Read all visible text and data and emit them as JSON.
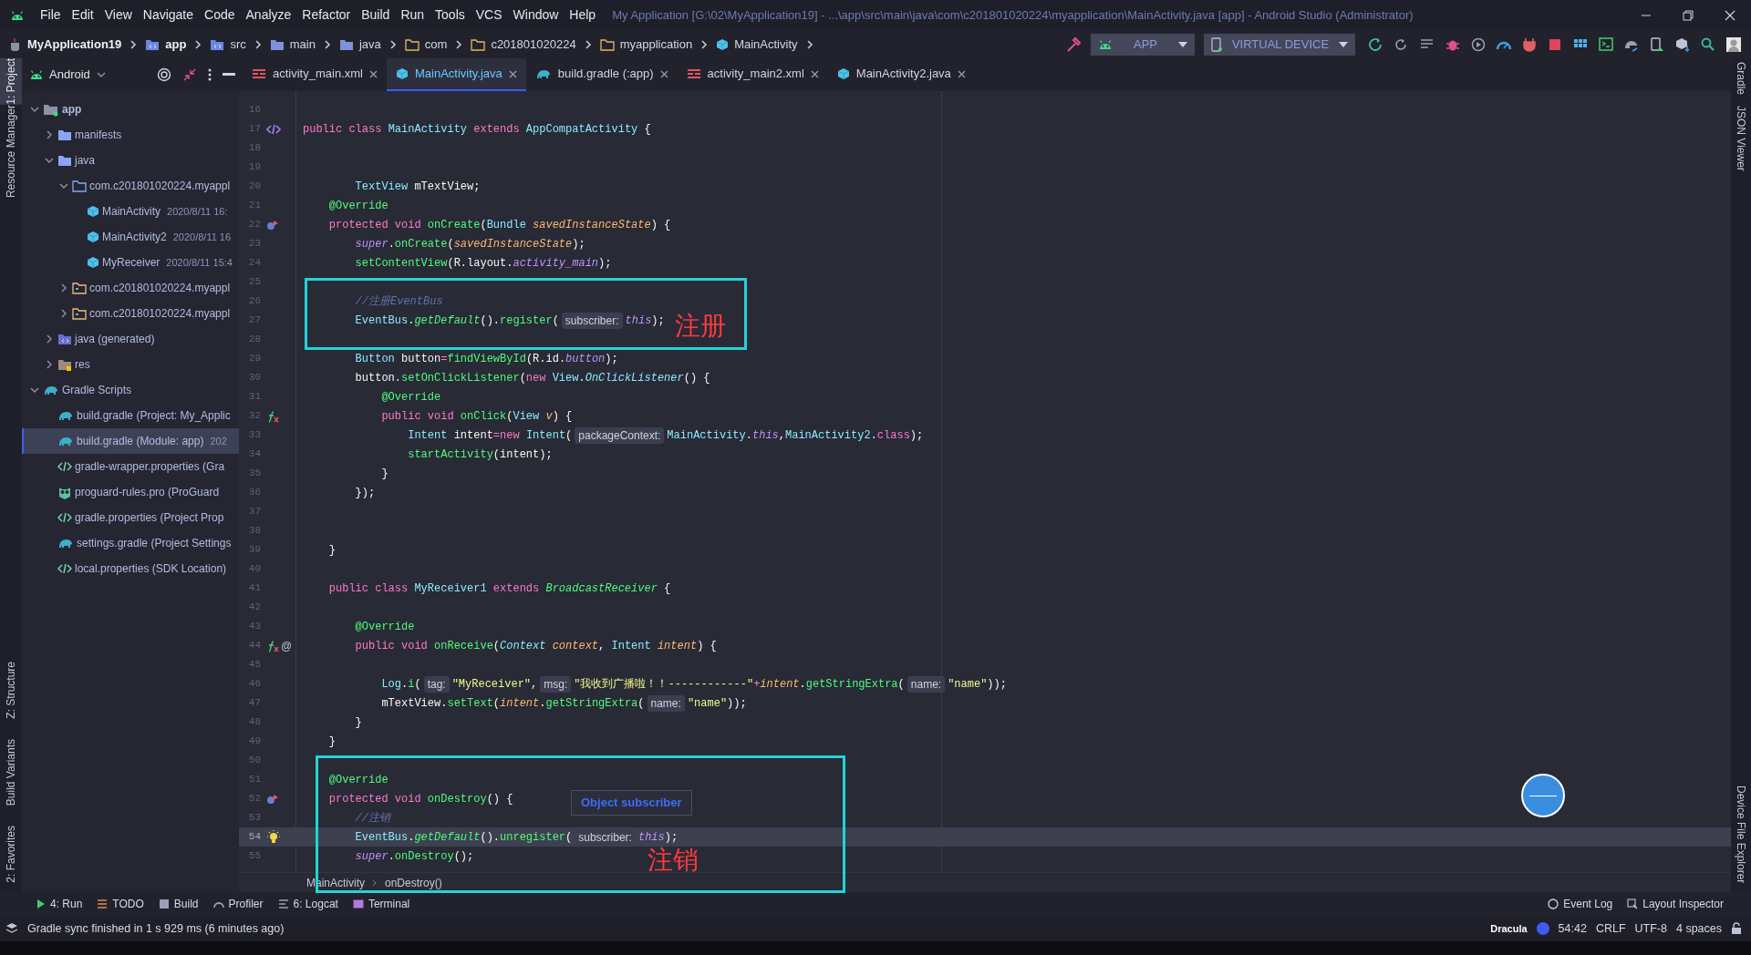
{
  "window": {
    "title": "My Application [G:\\02\\MyApplication19] - ...\\app\\src\\main\\java\\com\\c201801020224\\myapplication\\MainActivity.java [app] - Android Studio (Administrator)"
  },
  "menu": [
    "File",
    "Edit",
    "View",
    "Navigate",
    "Code",
    "Analyze",
    "Refactor",
    "Build",
    "Run",
    "Tools",
    "VCS",
    "Window",
    "Help"
  ],
  "breadcrumb": [
    {
      "label": "MyApplication19",
      "kind": "project"
    },
    {
      "label": "app",
      "kind": "module"
    },
    {
      "label": "src",
      "kind": "source"
    },
    {
      "label": "main",
      "kind": "folder"
    },
    {
      "label": "java",
      "kind": "folder"
    },
    {
      "label": "com",
      "kind": "package"
    },
    {
      "label": "c201801020224",
      "kind": "package"
    },
    {
      "label": "myapplication",
      "kind": "package"
    },
    {
      "label": "MainActivity",
      "kind": "class"
    }
  ],
  "toolbar": {
    "run_config": "APP",
    "device": "VIRTUAL DEVICE"
  },
  "left_strip": {
    "top": [
      {
        "label": "1: Project",
        "selected": true
      },
      {
        "label": "Resource Manager",
        "selected": false
      }
    ],
    "bottom": [
      {
        "label": "Z: Structure",
        "selected": false
      },
      {
        "label": "Build Variants",
        "selected": false
      },
      {
        "label": "2: Favorites",
        "selected": false
      }
    ]
  },
  "right_strip": {
    "top": [
      "Gradle",
      "JSON Viewer"
    ],
    "bottom": [
      "Device File Explorer"
    ]
  },
  "project_panel": {
    "view": "Android",
    "tree": [
      {
        "label": "app",
        "kind": "module",
        "expanded": true,
        "selected": false,
        "children": [
          {
            "label": "manifests",
            "kind": "folder",
            "expanded": false,
            "selected": false
          },
          {
            "label": "java",
            "kind": "folder",
            "expanded": true,
            "selected": false,
            "children": [
              {
                "label": "com.c201801020224.myappl",
                "kind": "package",
                "expanded": true,
                "selected": false,
                "children": [
                  {
                    "label": "MainActivity",
                    "detail": "2020/8/11 16:",
                    "kind": "class",
                    "selected": false
                  },
                  {
                    "label": "MainActivity2",
                    "detail": "2020/8/11 16",
                    "kind": "class",
                    "selected": false
                  },
                  {
                    "label": "MyReceiver",
                    "detail": "2020/8/11 15:4",
                    "kind": "class",
                    "selected": false
                  }
                ]
              },
              {
                "label": "com.c201801020224.myappl",
                "kind": "test-package",
                "expanded": false,
                "selected": false
              },
              {
                "label": "com.c201801020224.myappl",
                "kind": "test-package",
                "expanded": false,
                "selected": false
              }
            ]
          },
          {
            "label": "java (generated)",
            "kind": "generated",
            "expanded": false,
            "selected": false
          },
          {
            "label": "res",
            "kind": "res",
            "expanded": false,
            "selected": false
          }
        ]
      },
      {
        "label": "Gradle Scripts",
        "kind": "gradle",
        "expanded": true,
        "selected": false,
        "children": [
          {
            "label": "build.gradle (Project: My_Applic",
            "kind": "gradle",
            "selected": false
          },
          {
            "label": "build.gradle (Module: app)",
            "detail": "202",
            "kind": "gradle",
            "selected": true
          },
          {
            "label": "gradle-wrapper.properties (Gra",
            "kind": "properties",
            "selected": false
          },
          {
            "label": "proguard-rules.pro (ProGuard",
            "kind": "proguard",
            "selected": false
          },
          {
            "label": "gradle.properties (Project Prop",
            "kind": "properties",
            "selected": false
          },
          {
            "label": "settings.gradle (Project Settings",
            "kind": "gradle",
            "selected": false
          },
          {
            "label": "local.properties (SDK Location)",
            "kind": "properties",
            "selected": false
          }
        ]
      }
    ]
  },
  "editor_tabs": [
    {
      "label": "activity_main.xml",
      "kind": "layout",
      "selected": false
    },
    {
      "label": "MainActivity.java",
      "kind": "class",
      "selected": true
    },
    {
      "label": "build.gradle (:app)",
      "kind": "gradle",
      "selected": false
    },
    {
      "label": "activity_main2.xml",
      "kind": "layout",
      "selected": false
    },
    {
      "label": "MainActivity2.java",
      "kind": "class",
      "selected": false
    }
  ],
  "editor": {
    "lines": [
      {
        "number": "16",
        "current": false
      },
      {
        "number": "17",
        "current": false,
        "marker": {
          "kind": "class"
        },
        "tokens": [
          {
            "kind": "keyword",
            "text": "public class "
          },
          {
            "kind": "type",
            "text": "MainActivity "
          },
          {
            "kind": "keyword",
            "text": "extends "
          },
          {
            "kind": "type",
            "text": "AppCompatActivity "
          },
          {
            "kind": "plain",
            "text": "{"
          }
        ]
      },
      {
        "number": "18",
        "current": false
      },
      {
        "number": "19",
        "current": false
      },
      {
        "number": "20",
        "current": false,
        "tokens": [
          {
            "kind": "type",
            "text": "        TextView "
          },
          {
            "kind": "plain",
            "text": "mTextView;"
          }
        ]
      },
      {
        "number": "21",
        "current": false,
        "tokens": [
          {
            "kind": "annotation",
            "text": "    @Override"
          }
        ]
      },
      {
        "number": "22",
        "current": false,
        "marker": {
          "kind": "override"
        },
        "tokens": [
          {
            "kind": "keyword",
            "text": "    protected void "
          },
          {
            "kind": "function",
            "text": "onCreate"
          },
          {
            "kind": "plain",
            "text": "("
          },
          {
            "kind": "type",
            "text": "Bundle "
          },
          {
            "kind": "parameter",
            "text": "savedInstanceState"
          },
          {
            "kind": "plain",
            "text": ") {"
          }
        ]
      },
      {
        "number": "23",
        "current": false,
        "tokens": [
          {
            "kind": "this",
            "text": "        super"
          },
          {
            "kind": "plain",
            "text": "."
          },
          {
            "kind": "function",
            "text": "onCreate"
          },
          {
            "kind": "plain",
            "text": "("
          },
          {
            "kind": "parameter",
            "text": "savedInstanceState"
          },
          {
            "kind": "plain",
            "text": ");"
          }
        ]
      },
      {
        "number": "24",
        "current": false,
        "tokens": [
          {
            "kind": "function",
            "text": "        setContentView"
          },
          {
            "kind": "plain",
            "text": "(R.layout."
          },
          {
            "kind": "this",
            "text": "activity_main"
          },
          {
            "kind": "plain",
            "text": ");"
          }
        ]
      },
      {
        "number": "25",
        "current": false
      },
      {
        "number": "26",
        "current": false,
        "tokens": [
          {
            "kind": "comment",
            "text": "        //注册EventBus"
          }
        ]
      },
      {
        "number": "27",
        "current": false,
        "tokens": [
          {
            "kind": "type",
            "text": "        EventBus"
          },
          {
            "kind": "plain",
            "text": "."
          },
          {
            "kind": "static",
            "text": "getDefault"
          },
          {
            "kind": "plain",
            "text": "()."
          },
          {
            "kind": "function",
            "text": "register"
          },
          {
            "kind": "plain",
            "text": "("
          },
          {
            "kind": "hint",
            "text": "subscriber:"
          },
          {
            "kind": "this",
            "text": "this"
          },
          {
            "kind": "plain",
            "text": ");"
          }
        ]
      },
      {
        "number": "28",
        "current": false
      },
      {
        "number": "29",
        "current": false,
        "tokens": [
          {
            "kind": "type",
            "text": "        Button "
          },
          {
            "kind": "plain",
            "text": "button"
          },
          {
            "kind": "keyword",
            "text": "="
          },
          {
            "kind": "function",
            "text": "findViewById"
          },
          {
            "kind": "plain",
            "text": "(R.id."
          },
          {
            "kind": "this",
            "text": "button"
          },
          {
            "kind": "plain",
            "text": ");"
          }
        ]
      },
      {
        "number": "30",
        "current": false,
        "tokens": [
          {
            "kind": "plain",
            "text": "        button."
          },
          {
            "kind": "function",
            "text": "setOnClickListener"
          },
          {
            "kind": "plain",
            "text": "("
          },
          {
            "kind": "keyword",
            "text": "new "
          },
          {
            "kind": "type",
            "text": "View"
          },
          {
            "kind": "plain",
            "text": "."
          },
          {
            "kind": "italic-type",
            "text": "OnClickListener"
          },
          {
            "kind": "plain",
            "text": "() {"
          }
        ]
      },
      {
        "number": "31",
        "current": false,
        "tokens": [
          {
            "kind": "annotation",
            "text": "            @Override"
          }
        ]
      },
      {
        "number": "32",
        "current": false,
        "marker": {
          "kind": "implement"
        },
        "tokens": [
          {
            "kind": "keyword",
            "text": "            public void "
          },
          {
            "kind": "function",
            "text": "onClick"
          },
          {
            "kind": "plain",
            "text": "("
          },
          {
            "kind": "type",
            "text": "View "
          },
          {
            "kind": "parameter",
            "text": "v"
          },
          {
            "kind": "plain",
            "text": ") {"
          }
        ]
      },
      {
        "number": "33",
        "current": false,
        "tokens": [
          {
            "kind": "type",
            "text": "                Intent "
          },
          {
            "kind": "plain",
            "text": "intent"
          },
          {
            "kind": "keyword",
            "text": "=new "
          },
          {
            "kind": "type",
            "text": "Intent"
          },
          {
            "kind": "plain",
            "text": "("
          },
          {
            "kind": "hint",
            "text": "packageContext:"
          },
          {
            "kind": "type",
            "text": "MainActivity"
          },
          {
            "kind": "plain",
            "text": "."
          },
          {
            "kind": "this",
            "text": "this"
          },
          {
            "kind": "plain",
            "text": ","
          },
          {
            "kind": "type",
            "text": "MainActivity2"
          },
          {
            "kind": "plain",
            "text": "."
          },
          {
            "kind": "keyword",
            "text": "class"
          },
          {
            "kind": "plain",
            "text": ");"
          }
        ]
      },
      {
        "number": "34",
        "current": false,
        "tokens": [
          {
            "kind": "function",
            "text": "                startActivity"
          },
          {
            "kind": "plain",
            "text": "(intent);"
          }
        ]
      },
      {
        "number": "35",
        "current": false,
        "tokens": [
          {
            "kind": "plain",
            "text": "            }"
          }
        ]
      },
      {
        "number": "36",
        "current": false,
        "tokens": [
          {
            "kind": "plain",
            "text": "        });"
          }
        ]
      },
      {
        "number": "37",
        "current": false
      },
      {
        "number": "38",
        "current": false
      },
      {
        "number": "39",
        "current": false,
        "tokens": [
          {
            "kind": "plain",
            "text": "    }"
          }
        ]
      },
      {
        "number": "40",
        "current": false
      },
      {
        "number": "41",
        "current": false,
        "tokens": [
          {
            "kind": "keyword",
            "text": "    public class "
          },
          {
            "kind": "type",
            "text": "MyReceiver1 "
          },
          {
            "kind": "keyword",
            "text": "extends "
          },
          {
            "kind": "static",
            "text": "BroadcastReceiver"
          },
          {
            "kind": "plain",
            "text": " {"
          }
        ]
      },
      {
        "number": "42",
        "current": false
      },
      {
        "number": "43",
        "current": false,
        "tokens": [
          {
            "kind": "annotation",
            "text": "        @Override"
          }
        ]
      },
      {
        "number": "44",
        "current": false,
        "marker": {
          "kind": "implement"
        },
        "gutter_text": "@",
        "tokens": [
          {
            "kind": "keyword",
            "text": "        public void "
          },
          {
            "kind": "function",
            "text": "onReceive"
          },
          {
            "kind": "plain",
            "text": "("
          },
          {
            "kind": "italic-type",
            "text": "Context "
          },
          {
            "kind": "parameter",
            "text": "context"
          },
          {
            "kind": "plain",
            "text": ", "
          },
          {
            "kind": "type",
            "text": "Intent "
          },
          {
            "kind": "parameter",
            "text": "intent"
          },
          {
            "kind": "plain",
            "text": ") {"
          }
        ]
      },
      {
        "number": "45",
        "current": false
      },
      {
        "number": "46",
        "current": false,
        "tokens": [
          {
            "kind": "type",
            "text": "            Log"
          },
          {
            "kind": "plain",
            "text": "."
          },
          {
            "kind": "function",
            "text": "i"
          },
          {
            "kind": "plain",
            "text": "("
          },
          {
            "kind": "hint",
            "text": "tag:"
          },
          {
            "kind": "string",
            "text": "\"MyReceiver\""
          },
          {
            "kind": "plain",
            "text": ","
          },
          {
            "kind": "hint",
            "text": "msg:"
          },
          {
            "kind": "string",
            "text": "\"我收到广播啦！！------------\""
          },
          {
            "kind": "keyword",
            "text": "+"
          },
          {
            "kind": "parameter",
            "text": "intent"
          },
          {
            "kind": "plain",
            "text": "."
          },
          {
            "kind": "function",
            "text": "getStringExtra"
          },
          {
            "kind": "plain",
            "text": "("
          },
          {
            "kind": "hint",
            "text": "name:"
          },
          {
            "kind": "string",
            "text": "\"name\""
          },
          {
            "kind": "plain",
            "text": "));"
          }
        ]
      },
      {
        "number": "47",
        "current": false,
        "tokens": [
          {
            "kind": "plain",
            "text": "            mTextView."
          },
          {
            "kind": "function",
            "text": "setText"
          },
          {
            "kind": "plain",
            "text": "("
          },
          {
            "kind": "parameter",
            "text": "intent"
          },
          {
            "kind": "plain",
            "text": "."
          },
          {
            "kind": "function",
            "text": "getStringExtra"
          },
          {
            "kind": "plain",
            "text": "("
          },
          {
            "kind": "hint",
            "text": "name:"
          },
          {
            "kind": "string",
            "text": "\"name\""
          },
          {
            "kind": "plain",
            "text": "));"
          }
        ]
      },
      {
        "number": "48",
        "current": false,
        "tokens": [
          {
            "kind": "plain",
            "text": "        }"
          }
        ]
      },
      {
        "number": "49",
        "current": false,
        "tokens": [
          {
            "kind": "plain",
            "text": "    }"
          }
        ]
      },
      {
        "number": "50",
        "current": false
      },
      {
        "number": "51",
        "current": false,
        "tokens": [
          {
            "kind": "annotation",
            "text": "    @Override"
          }
        ]
      },
      {
        "number": "52",
        "current": false,
        "marker": {
          "kind": "override"
        },
        "tokens": [
          {
            "kind": "keyword",
            "text": "    protected void "
          },
          {
            "kind": "function",
            "text": "onDestroy"
          },
          {
            "kind": "plain",
            "text": "() {"
          }
        ]
      },
      {
        "number": "53",
        "current": false,
        "tokens": [
          {
            "kind": "comment",
            "text": "        //注销"
          }
        ]
      },
      {
        "number": "54",
        "current": true,
        "marker": {
          "kind": "bulb"
        },
        "tokens": [
          {
            "kind": "type",
            "text": "        EventBus"
          },
          {
            "kind": "plain",
            "text": "."
          },
          {
            "kind": "static",
            "text": "getDefault"
          },
          {
            "kind": "plain",
            "text": "()."
          },
          {
            "kind": "function",
            "text": "unregister"
          },
          {
            "kind": "plain",
            "text": "("
          },
          {
            "kind": "hint",
            "text": "subscriber:"
          },
          {
            "kind": "this",
            "text": "this"
          },
          {
            "kind": "plain",
            "text": ");"
          }
        ]
      },
      {
        "number": "55",
        "current": false,
        "tokens": [
          {
            "kind": "this",
            "text": "        super"
          },
          {
            "kind": "plain",
            "text": "."
          },
          {
            "kind": "function",
            "text": "onDestroy"
          },
          {
            "kind": "plain",
            "text": "();"
          }
        ]
      }
    ],
    "tooltip": "Object subscriber",
    "annotations": [
      "注册",
      "注销"
    ],
    "breadcrumb": [
      "MainActivity",
      "onDestroy()"
    ]
  },
  "tool_windows": {
    "left": [
      "4: Run",
      "TODO",
      "Build",
      "Profiler",
      "6: Logcat",
      "Terminal"
    ],
    "right": [
      "Event Log",
      "Layout Inspector"
    ]
  },
  "status_bar": {
    "message": "Gradle sync finished in 1 s 929 ms (6 minutes ago)",
    "theme": "Dracula",
    "position": "54:42",
    "line_separator": "CRLF",
    "encoding": "UTF-8",
    "indent": "4 spaces"
  }
}
